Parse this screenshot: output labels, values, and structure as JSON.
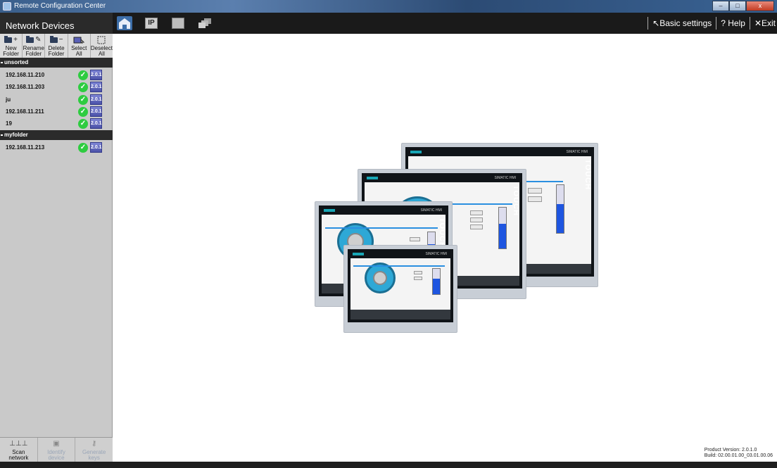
{
  "window": {
    "title": "Remote Configuration Center",
    "buttons": [
      "–",
      "□",
      "x"
    ]
  },
  "sidebar": {
    "title": "Network Devices",
    "tools": [
      {
        "label1": "New",
        "label2": "Folder",
        "symbol": "+"
      },
      {
        "label1": "Rename",
        "label2": "Folder",
        "symbol": "✎"
      },
      {
        "label1": "Delete",
        "label2": "Folder",
        "symbol": "−"
      },
      {
        "label1": "Select",
        "label2": "All"
      },
      {
        "label1": "Deselect",
        "label2": "All"
      }
    ],
    "groups": [
      {
        "name": "unsorted"
      },
      {
        "name": "myfolder"
      }
    ],
    "devices": [
      {
        "name": "192.168.11.210",
        "version": "2.0.1",
        "status": "online"
      },
      {
        "name": "192.168.11.203",
        "version": "2.0.1",
        "status": "online"
      },
      {
        "name": "ju",
        "version": "2.0.1",
        "status": "online"
      },
      {
        "name": "192.168.11.211",
        "version": "2.0.1",
        "status": "online"
      },
      {
        "name": "19",
        "version": "2.0.1",
        "status": "online"
      },
      {
        "name": "192.168.11.213",
        "version": "2.0.1",
        "status": "online"
      }
    ],
    "bottom_tools": [
      {
        "label1": "Scan",
        "label2": "network",
        "enabled": true
      },
      {
        "label1": "Identify",
        "label2": "device",
        "enabled": false
      },
      {
        "label1": "Generate",
        "label2": "keys",
        "enabled": false
      }
    ]
  },
  "topbar": {
    "nav_ip_label": "IP",
    "links": {
      "basic_settings": "↖Basic settings",
      "help": "? Help",
      "exit": "✕Exit"
    }
  },
  "panels": {
    "model_label": "SIMATIC HMI",
    "touch_label": "TOUCH"
  },
  "version_info": {
    "product": "Product Version: 2.0.1.0",
    "build": "Build: 02.00.01.00_03.01.00.06"
  },
  "colors": {
    "accent_blue": "#3d6ea8",
    "check_green": "#2ecc40",
    "version_badge": "#5a61b8",
    "sidebar_bg": "#c9c9c9"
  }
}
